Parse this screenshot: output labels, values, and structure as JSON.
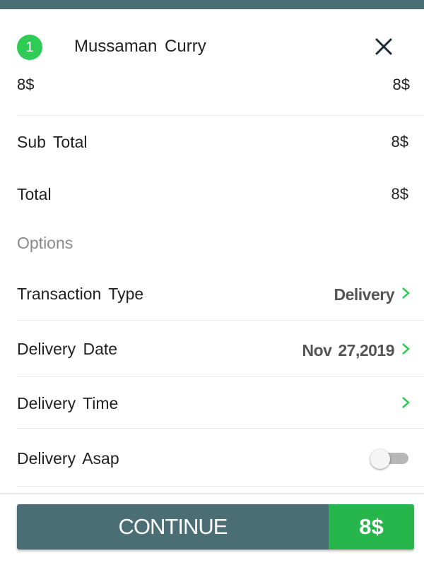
{
  "cart_item": {
    "quantity": "1",
    "name": "Mussaman Curry",
    "unit_price": "8$",
    "line_total": "8$"
  },
  "summary": {
    "subtotal_label": "Sub Total",
    "subtotal_value": "8$",
    "total_label": "Total",
    "total_value": "8$"
  },
  "options": {
    "heading": "Options",
    "transaction_type": {
      "label": "Transaction Type",
      "value": "Delivery"
    },
    "delivery_date": {
      "label": "Delivery Date",
      "value": "Nov 27,2019"
    },
    "delivery_time": {
      "label": "Delivery Time",
      "value": ""
    },
    "delivery_asap": {
      "label": "Delivery Asap",
      "enabled": false
    }
  },
  "footer": {
    "continue_label": "CONTINUE",
    "total": "8$"
  },
  "colors": {
    "header_bar": "#4a6e74",
    "accent_green": "#2ecc55",
    "button_teal": "#4a6e74",
    "button_green": "#27b64c"
  }
}
